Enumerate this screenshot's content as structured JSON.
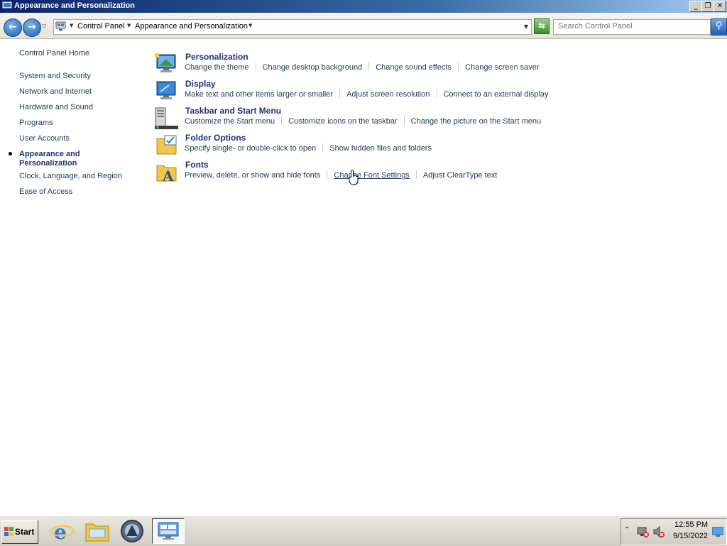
{
  "window": {
    "title": "Appearance and Personalization"
  },
  "address": {
    "segments": [
      "Control Panel",
      "Appearance and Personalization"
    ],
    "search_placeholder": "Search Control Panel"
  },
  "sidebar": {
    "home": "Control Panel Home",
    "items": [
      {
        "label": "System and Security",
        "active": false
      },
      {
        "label": "Network and Internet",
        "active": false
      },
      {
        "label": "Hardware and Sound",
        "active": false
      },
      {
        "label": "Programs",
        "active": false
      },
      {
        "label": "User Accounts",
        "active": false
      },
      {
        "label": "Appearance and Personalization",
        "active": true
      },
      {
        "label": "Clock, Language, and Region",
        "active": false
      },
      {
        "label": "Ease of Access",
        "active": false
      }
    ]
  },
  "categories": [
    {
      "title": "Personalization",
      "icon": "personalization-icon",
      "links": [
        "Change the theme",
        "Change desktop background",
        "Change sound effects",
        "Change screen saver"
      ]
    },
    {
      "title": "Display",
      "icon": "display-icon",
      "links": [
        "Make text and other items larger or smaller",
        "Adjust screen resolution",
        "Connect to an external display"
      ]
    },
    {
      "title": "Taskbar and Start Menu",
      "icon": "taskbar-icon",
      "links": [
        "Customize the Start menu",
        "Customize icons on the taskbar",
        "Change the picture on the Start menu"
      ]
    },
    {
      "title": "Folder Options",
      "icon": "folder-options-icon",
      "links": [
        "Specify single- or double-click to open",
        "Show hidden files and folders"
      ]
    },
    {
      "title": "Fonts",
      "icon": "fonts-icon",
      "links": [
        "Preview, delete, or show and hide fonts",
        "Change Font Settings",
        "Adjust ClearType text"
      ]
    }
  ],
  "taskbar": {
    "start_label": "Start",
    "apps": [
      "internet-explorer-icon",
      "file-explorer-icon",
      "media-center-icon",
      "control-panel-icon"
    ],
    "clock_time": "12:55 PM",
    "clock_date": "9/15/2022"
  },
  "colors": {
    "link": "#1e395b",
    "heading": "#1e3278",
    "titlebar": "#0a246a"
  }
}
